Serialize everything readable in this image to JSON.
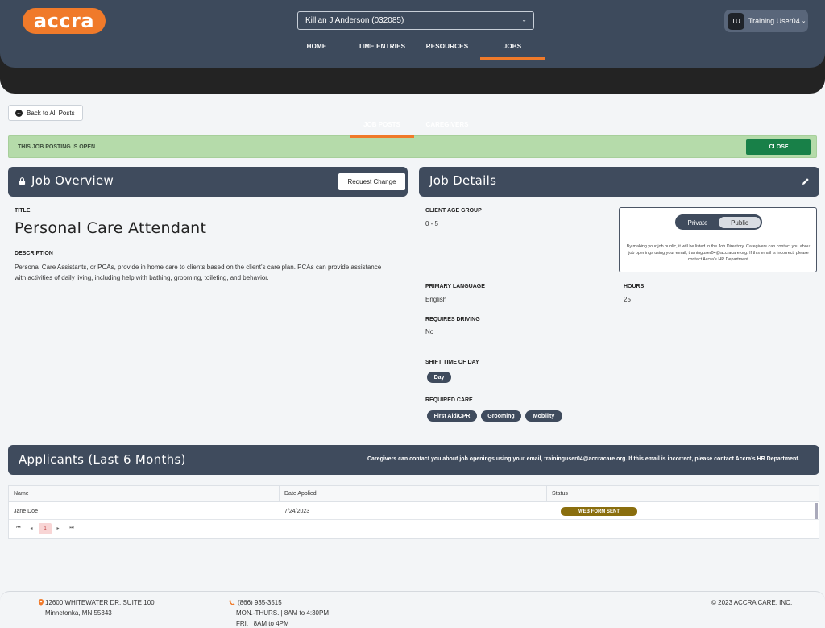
{
  "header": {
    "logo_text": "accra",
    "client_select": "Killian J Anderson (032085)",
    "user": {
      "initials": "TU",
      "name": "Training User04"
    },
    "nav": [
      "HOME",
      "TIME ENTRIES",
      "RESOURCES",
      "JOBS"
    ],
    "active_nav": "JOBS",
    "subnav": [
      "JOB POSTS",
      "CAREGIVERS"
    ],
    "active_subnav": "JOB POSTS"
  },
  "back_label": "Back to All Posts",
  "status": {
    "text": "THIS JOB POSTING IS OPEN",
    "close_label": "CLOSE"
  },
  "overview": {
    "heading": "Job Overview",
    "request_change_label": "Request Change",
    "title_label": "TITLE",
    "title": "Personal Care Attendant",
    "description_label": "DESCRIPTION",
    "description": "Personal Care Assistants, or PCAs, provide in home care to clients based on the client’s care plan. PCAs can provide assistance with activities of daily living, including help with bathing, grooming, toileting, and behavior."
  },
  "details": {
    "heading": "Job Details",
    "client_age_group_label": "CLIENT AGE GROUP",
    "client_age_group": "0 - 5",
    "visibility": {
      "options": [
        "Private",
        "Public"
      ],
      "selected": "Public",
      "note": "By making your job public, it will be listed in the Job Directory. Caregivers can contact you about job openings using your email, traininguser04@accracare.org. If this email is incorrect, please contact Accra’s HR Department."
    },
    "primary_language_label": "PRIMARY LANGUAGE",
    "primary_language": "English",
    "hours_label": "HOURS",
    "hours": "25",
    "requires_driving_label": "REQUIRES DRIVING",
    "requires_driving": "No",
    "shift_label": "SHIFT TIME OF DAY",
    "shifts": [
      "Day"
    ],
    "required_care_label": "REQUIRED CARE",
    "required_care": [
      "First Aid/CPR",
      "Grooming",
      "Mobility"
    ]
  },
  "applicants": {
    "heading": "Applicants (Last 6 Months)",
    "note": "Caregivers can contact you about job openings using your email, traininguser04@accracare.org. If this email is incorrect, please contact Accra’s HR Department.",
    "columns": [
      "Name",
      "Date Applied",
      "Status"
    ],
    "rows": [
      {
        "name": "Jane Doe",
        "date": "7/24/2023",
        "status": "WEB FORM SENT"
      }
    ],
    "pager": {
      "first": "⏮",
      "prev": "◂",
      "page": "1",
      "next": "▸",
      "last": "⏭"
    }
  },
  "footer": {
    "address1": "12600 WHITEWATER DR. SUITE 100",
    "address2": "Minnetonka, MN 55343",
    "phone": "(866) 935-3515",
    "hours1": "MON.-THURS. | 8AM to 4:30PM",
    "hours2": "FRI. | 8AM to 4PM",
    "copyright": "2023 ACCRA CARE, INC.",
    "copyright_symbol": "©"
  },
  "colors": {
    "brand_orange": "#f07a2a",
    "header": "#3d4a5c",
    "open_green": "#b5dbaa",
    "close_btn": "#188048",
    "status_badge": "#8a6e0e"
  }
}
